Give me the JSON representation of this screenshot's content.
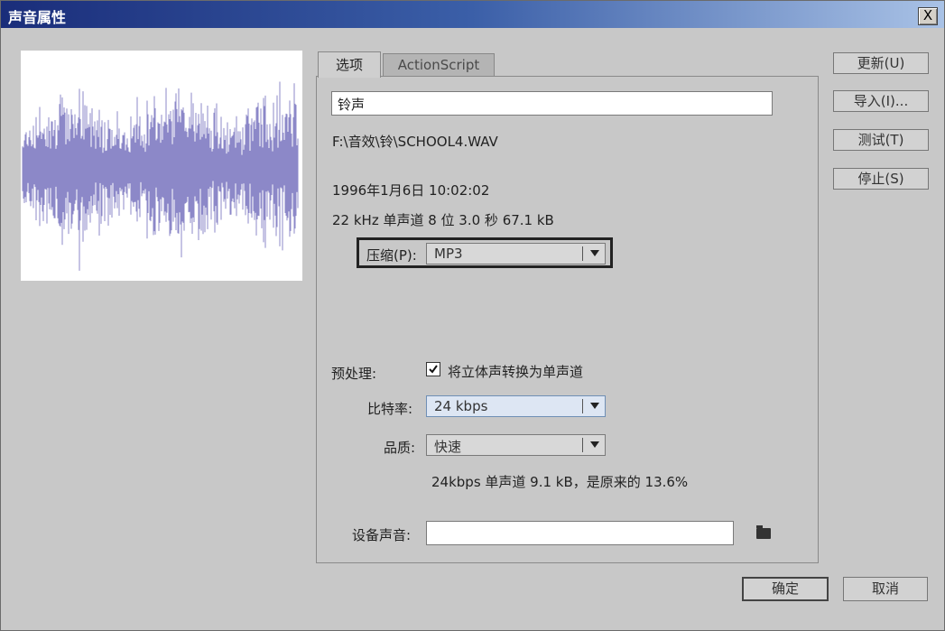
{
  "window": {
    "title": "声音属性",
    "close_label": "X"
  },
  "tabs": [
    {
      "label": "选项"
    },
    {
      "label": "ActionScript"
    }
  ],
  "sound": {
    "name_value": "铃声",
    "path": "F:\\音效\\铃\\SCHOOL4.WAV",
    "date": "1996年1月6日  10:02:02",
    "info": "22 kHz 单声道 8 位 3.0 秒 67.1 kB"
  },
  "compression": {
    "label": "压缩(P):",
    "value": "MP3"
  },
  "preprocess": {
    "label": "预处理:",
    "checkbox_label": "将立体声转换为单声道",
    "checked": true
  },
  "bitrate": {
    "label": "比特率:",
    "value": "24 kbps"
  },
  "quality": {
    "label": "品质:",
    "value": "快速"
  },
  "summary": "24kbps  单声道 9.1 kB，是原来的 13.6%",
  "device": {
    "label": "设备声音:",
    "value": ""
  },
  "buttons": {
    "update": "更新(U)",
    "import": "导入(I)...",
    "test": "测试(T)",
    "stop": "停止(S)",
    "ok": "确定",
    "cancel": "取消"
  },
  "colors": {
    "waveform": "#8c88c8",
    "titlebar_start": "#1a2d7a",
    "titlebar_end": "#a9c2e6"
  }
}
